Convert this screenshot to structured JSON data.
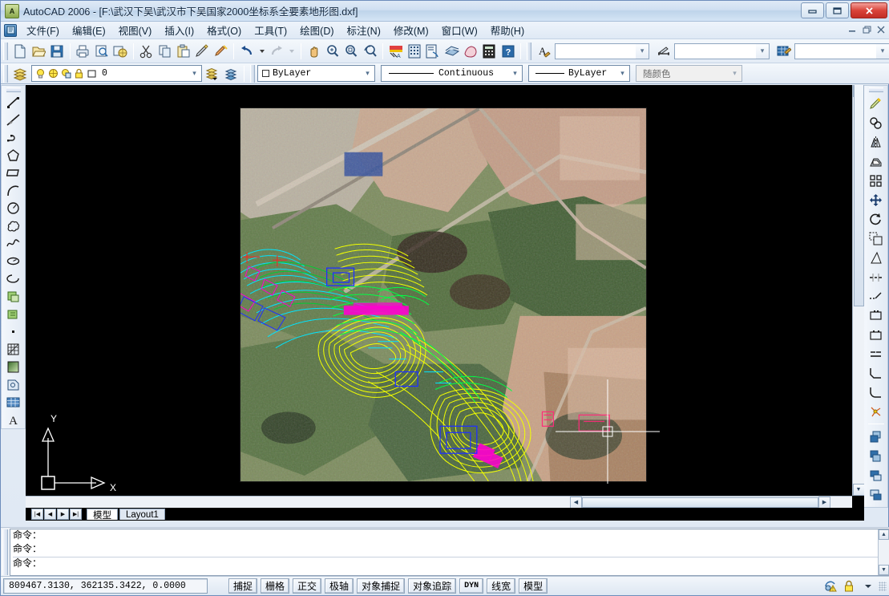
{
  "window": {
    "title": "AutoCAD 2006 - [F:\\武汉下吴\\武汉市下吴国家2000坐标系全要素地形图.dxf]",
    "app_icon": "autocad-icon",
    "buttons": {
      "minimize": "–",
      "maximize": "❐",
      "close": "✕"
    },
    "mdi_buttons": {
      "minimize": "–",
      "restore": "❐",
      "close": "✕"
    }
  },
  "menubar": {
    "doc_icon": "document-icon",
    "items": [
      {
        "label": "文件(F)",
        "name": "menu-file"
      },
      {
        "label": "编辑(E)",
        "name": "menu-edit"
      },
      {
        "label": "视图(V)",
        "name": "menu-view"
      },
      {
        "label": "插入(I)",
        "name": "menu-insert"
      },
      {
        "label": "格式(O)",
        "name": "menu-format"
      },
      {
        "label": "工具(T)",
        "name": "menu-tools"
      },
      {
        "label": "绘图(D)",
        "name": "menu-draw"
      },
      {
        "label": "标注(N)",
        "name": "menu-dimension"
      },
      {
        "label": "修改(M)",
        "name": "menu-modify"
      },
      {
        "label": "窗口(W)",
        "name": "menu-window"
      },
      {
        "label": "帮助(H)",
        "name": "menu-help"
      }
    ]
  },
  "standard_toolbar": {
    "icons": [
      "new-file-icon",
      "open-file-icon",
      "save-icon",
      "plot-icon",
      "plot-preview-icon",
      "publish-icon",
      "cut-icon",
      "copy-icon",
      "paste-icon",
      "match-properties-icon",
      "block-editor-icon",
      "undo-icon",
      "redo-icon",
      "pan-icon",
      "zoom-realtime-icon",
      "zoom-window-icon",
      "zoom-previous-icon",
      "properties-icon",
      "design-center-icon",
      "tool-palettes-icon",
      "markup-set-icon",
      "sheet-set-icon",
      "calculator-icon",
      "help-icon"
    ],
    "styles": {
      "text_style_icon": "text-style-icon",
      "text_style_value": "",
      "dim_style_icon": "dimension-style-icon",
      "dim_style_value": "",
      "table_style_icon": "table-style-icon",
      "table_style_value": ""
    }
  },
  "layer_toolbar": {
    "layer_properties_icon": "layer-properties-icon",
    "layer": {
      "icons": [
        "lightbulb-on-icon",
        "sun-icon",
        "freeze-viewport-icon",
        "lock-icon",
        "color-swatch-icon"
      ],
      "value": "0"
    },
    "make_current_icon": "make-layer-current-icon",
    "previous_layer_icon": "layer-previous-icon",
    "color": {
      "value": "ByLayer",
      "swatch": "#ffffff"
    },
    "linetype": {
      "value": "Continuous"
    },
    "lineweight": {
      "value": "ByLayer"
    },
    "plot_style": {
      "value": "随颜色"
    }
  },
  "draw_toolbar": {
    "name": "draw-toolbar",
    "icons": [
      "line-icon",
      "construction-line-icon",
      "polyline-icon",
      "polygon-icon",
      "rectangle-icon",
      "arc-icon",
      "circle-icon",
      "revision-cloud-icon",
      "spline-icon",
      "ellipse-icon",
      "ellipse-arc-icon",
      "insert-block-icon",
      "make-block-icon",
      "point-icon",
      "hatch-icon",
      "gradient-icon",
      "region-icon",
      "table-icon",
      "multiline-text-icon"
    ]
  },
  "modify_toolbar": {
    "name": "modify-toolbar",
    "icons": [
      "erase-icon",
      "copy-object-icon",
      "mirror-icon",
      "offset-icon",
      "array-icon",
      "move-icon",
      "rotate-icon",
      "scale-icon",
      "stretch-icon",
      "trim-icon",
      "extend-icon",
      "break-at-point-icon",
      "break-icon",
      "join-icon",
      "chamfer-icon",
      "fillet-icon",
      "explode-icon",
      "draworder-front-icon",
      "draworder-back-icon",
      "draworder-above-icon",
      "draworder-below-icon"
    ]
  },
  "canvas": {
    "name": "drawing-area",
    "background": "#000000",
    "ucs_icon": {
      "x_label": "X",
      "y_label": "Y"
    },
    "crosshair": {
      "visible": true
    },
    "overlay_colors": {
      "contours": "#f2ff00",
      "secondary": "#00ff44",
      "cyan": "#00e5ff",
      "magenta": "#ff00d0",
      "blue": "#2030ff",
      "red": "#ff2020"
    }
  },
  "layout_tabs": {
    "nav": [
      "|◀",
      "◀",
      "▶",
      "▶|"
    ],
    "tabs": [
      {
        "label": "模型",
        "active": true,
        "name": "tab-model"
      },
      {
        "label": "Layout1",
        "active": false,
        "name": "tab-layout1"
      }
    ]
  },
  "command_line": {
    "lines": [
      "命令：",
      "命令：",
      "命令："
    ],
    "prompt": "命令："
  },
  "status_bar": {
    "coordinates": "809467.3130,  362135.3422,  0.0000",
    "toggles": [
      {
        "label": "捕捉",
        "name": "status-snap",
        "mono": false
      },
      {
        "label": "栅格",
        "name": "status-grid",
        "mono": false
      },
      {
        "label": "正交",
        "name": "status-ortho",
        "mono": false
      },
      {
        "label": "极轴",
        "name": "status-polar",
        "mono": false
      },
      {
        "label": "对象捕捉",
        "name": "status-osnap",
        "mono": false
      },
      {
        "label": "对象追踪",
        "name": "status-otrack",
        "mono": false
      },
      {
        "label": "DYN",
        "name": "status-dyn",
        "mono": true
      },
      {
        "label": "线宽",
        "name": "status-lineweight",
        "mono": false
      },
      {
        "label": "模型",
        "name": "status-model",
        "mono": false
      }
    ],
    "tray_icons": [
      "communication-center-icon",
      "manage-xrefs-icon",
      "tray-menu-icon"
    ]
  }
}
